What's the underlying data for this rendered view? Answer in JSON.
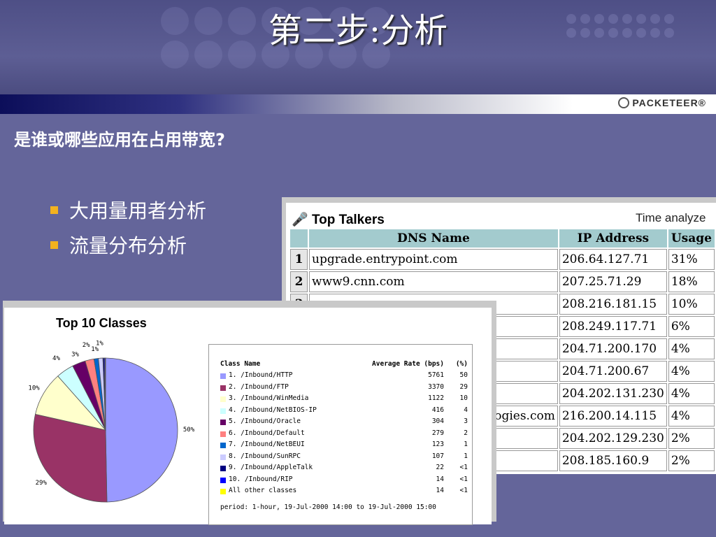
{
  "title": "第二步:分析",
  "question": "是谁或哪些应用在占用带宽?",
  "logo": "PACKETEER®",
  "bullets": [
    "大用量用者分析",
    "流量分布分析"
  ],
  "top_talkers": {
    "title": "Top Talkers",
    "time_label": "Time analyze",
    "headers": [
      "DNS Name",
      "IP Address",
      "Usage"
    ],
    "rows": [
      {
        "num": "1",
        "dns": "upgrade.entrypoint.com",
        "ip": "206.64.127.71",
        "usage": "31%"
      },
      {
        "num": "2",
        "dns": "www9.cnn.com",
        "ip": "207.25.71.29",
        "usage": "18%"
      },
      {
        "num": "3",
        "dns": "",
        "ip": "208.216.181.15",
        "usage": "10%"
      },
      {
        "num": "",
        "dns": "",
        "ip": "208.249.117.71",
        "usage": "6%"
      },
      {
        "num": "",
        "dns": "",
        "ip": "204.71.200.170",
        "usage": "4%"
      },
      {
        "num": "",
        "dns": "",
        "ip": "204.71.200.67",
        "usage": "4%"
      },
      {
        "num": "",
        "dns": "",
        "ip": "204.202.131.230",
        "usage": "4%"
      },
      {
        "num": "",
        "dns": "hnologies.com",
        "ip": "216.200.14.115",
        "usage": "4%"
      },
      {
        "num": "",
        "dns": "",
        "ip": "204.202.129.230",
        "usage": "2%"
      },
      {
        "num": "",
        "dns": "",
        "ip": "208.185.160.9",
        "usage": "2%"
      }
    ]
  },
  "top_classes": {
    "title": "Top 10 Classes",
    "legend_headers": {
      "name": "Class Name",
      "rate": "Average Rate (bps)",
      "pct": "(%)"
    },
    "classes": [
      {
        "name": "1. /Inbound/HTTP",
        "rate": "5761",
        "pct": "50",
        "value": 50,
        "color": "#9999ff"
      },
      {
        "name": "2. /Inbound/FTP",
        "rate": "3370",
        "pct": "29",
        "value": 29,
        "color": "#993366"
      },
      {
        "name": "3. /Inbound/WinMedia",
        "rate": "1122",
        "pct": "10",
        "value": 10,
        "color": "#ffffcc"
      },
      {
        "name": "4. /Inbound/NetBIOS-IP",
        "rate": "416",
        "pct": "4",
        "value": 4,
        "color": "#ccffff"
      },
      {
        "name": "5. /Inbound/Oracle",
        "rate": "304",
        "pct": "3",
        "value": 3,
        "color": "#660066"
      },
      {
        "name": "6. /Inbound/Default",
        "rate": "279",
        "pct": "2",
        "value": 2,
        "color": "#ff8080"
      },
      {
        "name": "7. /Inbound/NetBEUI",
        "rate": "123",
        "pct": "1",
        "value": 1,
        "color": "#0066cc"
      },
      {
        "name": "8. /Inbound/SunRPC",
        "rate": "107",
        "pct": "1",
        "value": 1,
        "color": "#ccccff"
      },
      {
        "name": "9. /Inbound/AppleTalk",
        "rate": "22",
        "pct": "<1",
        "value": 0.3,
        "color": "#000080"
      },
      {
        "name": "10. /Inbound/RIP",
        "rate": "14",
        "pct": "<1",
        "value": 0.2,
        "color": "#0000ff"
      },
      {
        "name": "All other classes",
        "rate": "14",
        "pct": "<1",
        "value": 0.1,
        "color": "#ffff00"
      }
    ],
    "pie_labels": [
      "50%",
      "29%",
      "10%",
      "4%",
      "3%",
      "2%",
      "1%",
      "1%"
    ],
    "period": "period: 1-hour, 19-Jul-2000 14:00 to 19-Jul-2000 15:00"
  },
  "chart_data": {
    "type": "pie",
    "title": "Top 10 Classes",
    "categories": [
      "/Inbound/HTTP",
      "/Inbound/FTP",
      "/Inbound/WinMedia",
      "/Inbound/NetBIOS-IP",
      "/Inbound/Oracle",
      "/Inbound/Default",
      "/Inbound/NetBEUI",
      "/Inbound/SunRPC",
      "/Inbound/AppleTalk",
      "/Inbound/RIP",
      "All other classes"
    ],
    "values": [
      50,
      29,
      10,
      4,
      3,
      2,
      1,
      1,
      0.3,
      0.2,
      0.1
    ]
  }
}
